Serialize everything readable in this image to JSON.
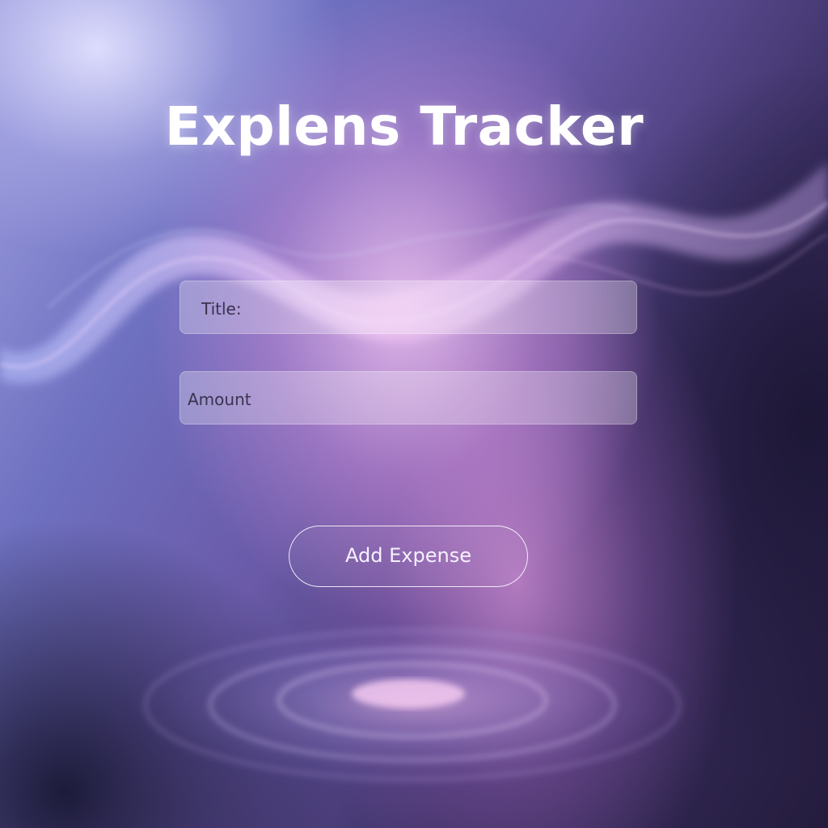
{
  "app": {
    "title": "Explens Tracker"
  },
  "form": {
    "title_field": {
      "label": "Title:"
    },
    "amount_field": {
      "label": "Amount"
    },
    "submit_label": "Add Expense"
  },
  "colors": {
    "accent_pink": "#e6a6ec",
    "accent_lavender": "#9fa0e0",
    "background_dark": "#241c3d",
    "text_white": "#ffffff"
  }
}
